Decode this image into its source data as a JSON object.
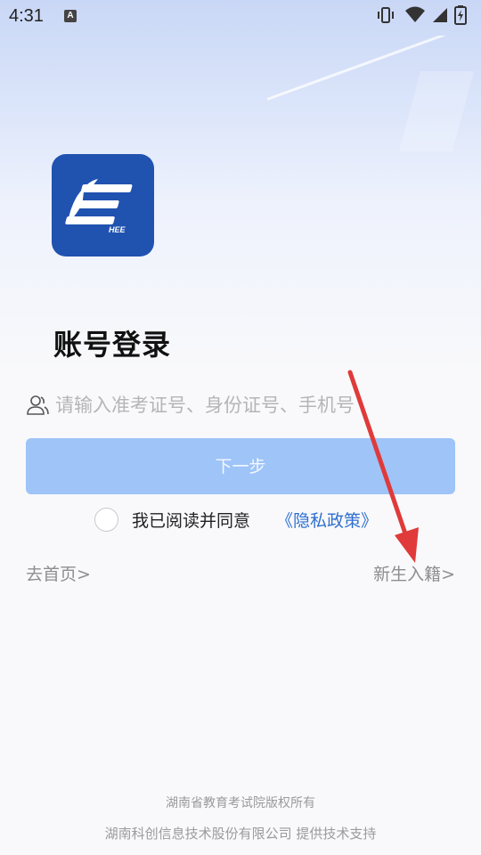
{
  "status_bar": {
    "time": "4:31",
    "notification_icon_letter": "A",
    "icons": [
      "vibrate-icon",
      "wifi-icon",
      "signal-icon",
      "battery-icon"
    ]
  },
  "login": {
    "title": "账号登录",
    "account_placeholder": "请输入准考证号、身份证号、手机号",
    "next_button_label": "下一步",
    "agree_text": "我已阅读并同意",
    "privacy_link": "《隐私政策》",
    "home_link": "去首页>",
    "enroll_link": "新生入籍>"
  },
  "logo": {
    "text": "HEE"
  },
  "footer": {
    "copyright": "湖南省教育考试院版权所有",
    "support": "湖南科创信息技术股份有限公司 提供技术支持"
  },
  "colors": {
    "primary": "#9ec4f8",
    "logo_bg": "#2052b0",
    "link": "#2f6fd0",
    "annotation_arrow": "#e03a3a"
  }
}
